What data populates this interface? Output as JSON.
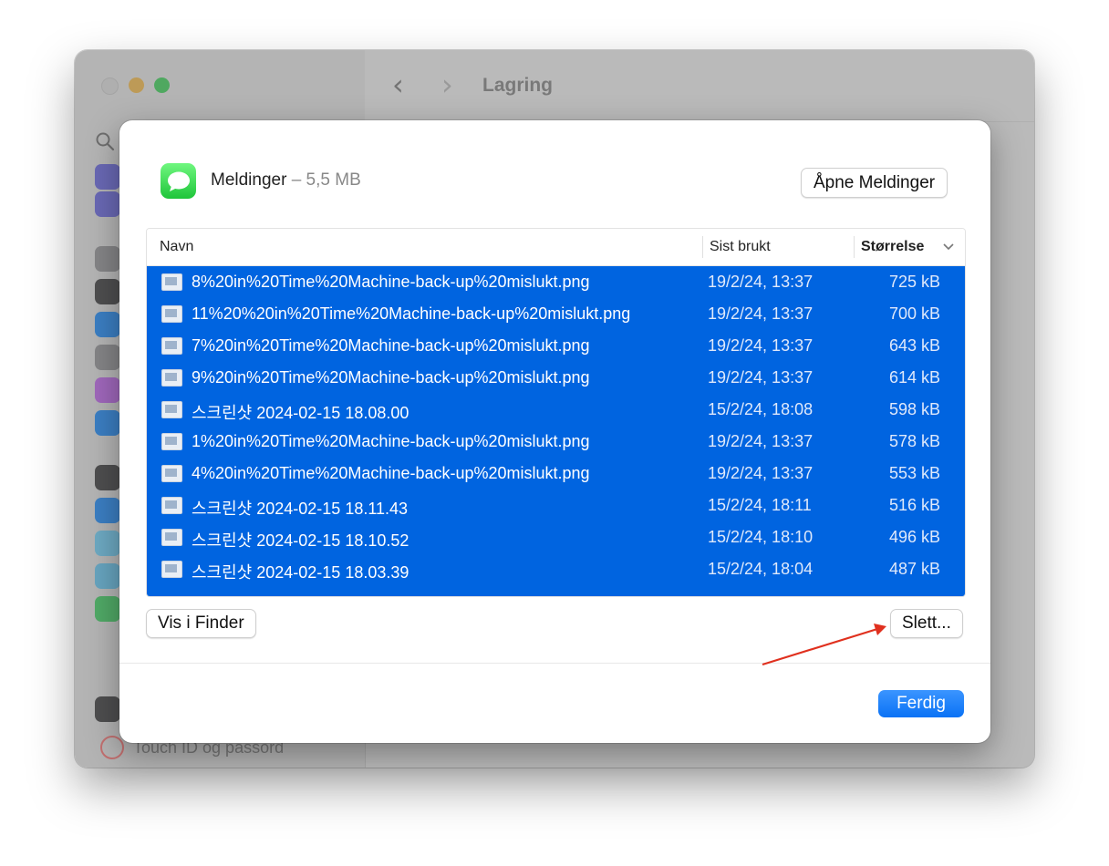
{
  "window": {
    "title": "Lagring",
    "sidebar_footer_label": "Touch ID og passord"
  },
  "colors": {
    "selection": "#0064e0",
    "accent": "#0a72f5",
    "arrow": "#e0301e"
  },
  "dialog": {
    "app_name": "Meldinger",
    "app_size": " – 5,5 MB",
    "open_button": "Åpne Meldinger",
    "table": {
      "columns": [
        "Navn",
        "Sist brukt",
        "Størrelse"
      ],
      "sort_indicator": "chevron-down-icon",
      "rows": [
        {
          "name": "8%20in%20Time%20Machine-back-up%20mislukt.png",
          "date": "19/2/24, 13:37",
          "size": "725 kB"
        },
        {
          "name": "11%20%20in%20Time%20Machine-back-up%20mislukt.png",
          "date": "19/2/24, 13:37",
          "size": "700 kB"
        },
        {
          "name": "7%20in%20Time%20Machine-back-up%20mislukt.png",
          "date": "19/2/24, 13:37",
          "size": "643 kB"
        },
        {
          "name": "9%20in%20Time%20Machine-back-up%20mislukt.png",
          "date": "19/2/24, 13:37",
          "size": "614 kB"
        },
        {
          "name": "스크린샷 2024-02-15 18.08.00",
          "date": "15/2/24, 18:08",
          "size": "598 kB"
        },
        {
          "name": "1%20in%20Time%20Machine-back-up%20mislukt.png",
          "date": "19/2/24, 13:37",
          "size": "578 kB"
        },
        {
          "name": "4%20in%20Time%20Machine-back-up%20mislukt.png",
          "date": "19/2/24, 13:37",
          "size": "553 kB"
        },
        {
          "name": "스크린샷 2024-02-15 18.11.43",
          "date": "15/2/24, 18:11",
          "size": "516 kB"
        },
        {
          "name": "스크린샷 2024-02-15 18.10.52",
          "date": "15/2/24, 18:10",
          "size": "496 kB"
        },
        {
          "name": "스크린샷 2024-02-15 18.03.39",
          "date": "15/2/24, 18:04",
          "size": "487 kB"
        }
      ]
    },
    "finder_button": "Vis i Finder",
    "delete_button": "Slett...",
    "done_button": "Ferdig"
  }
}
